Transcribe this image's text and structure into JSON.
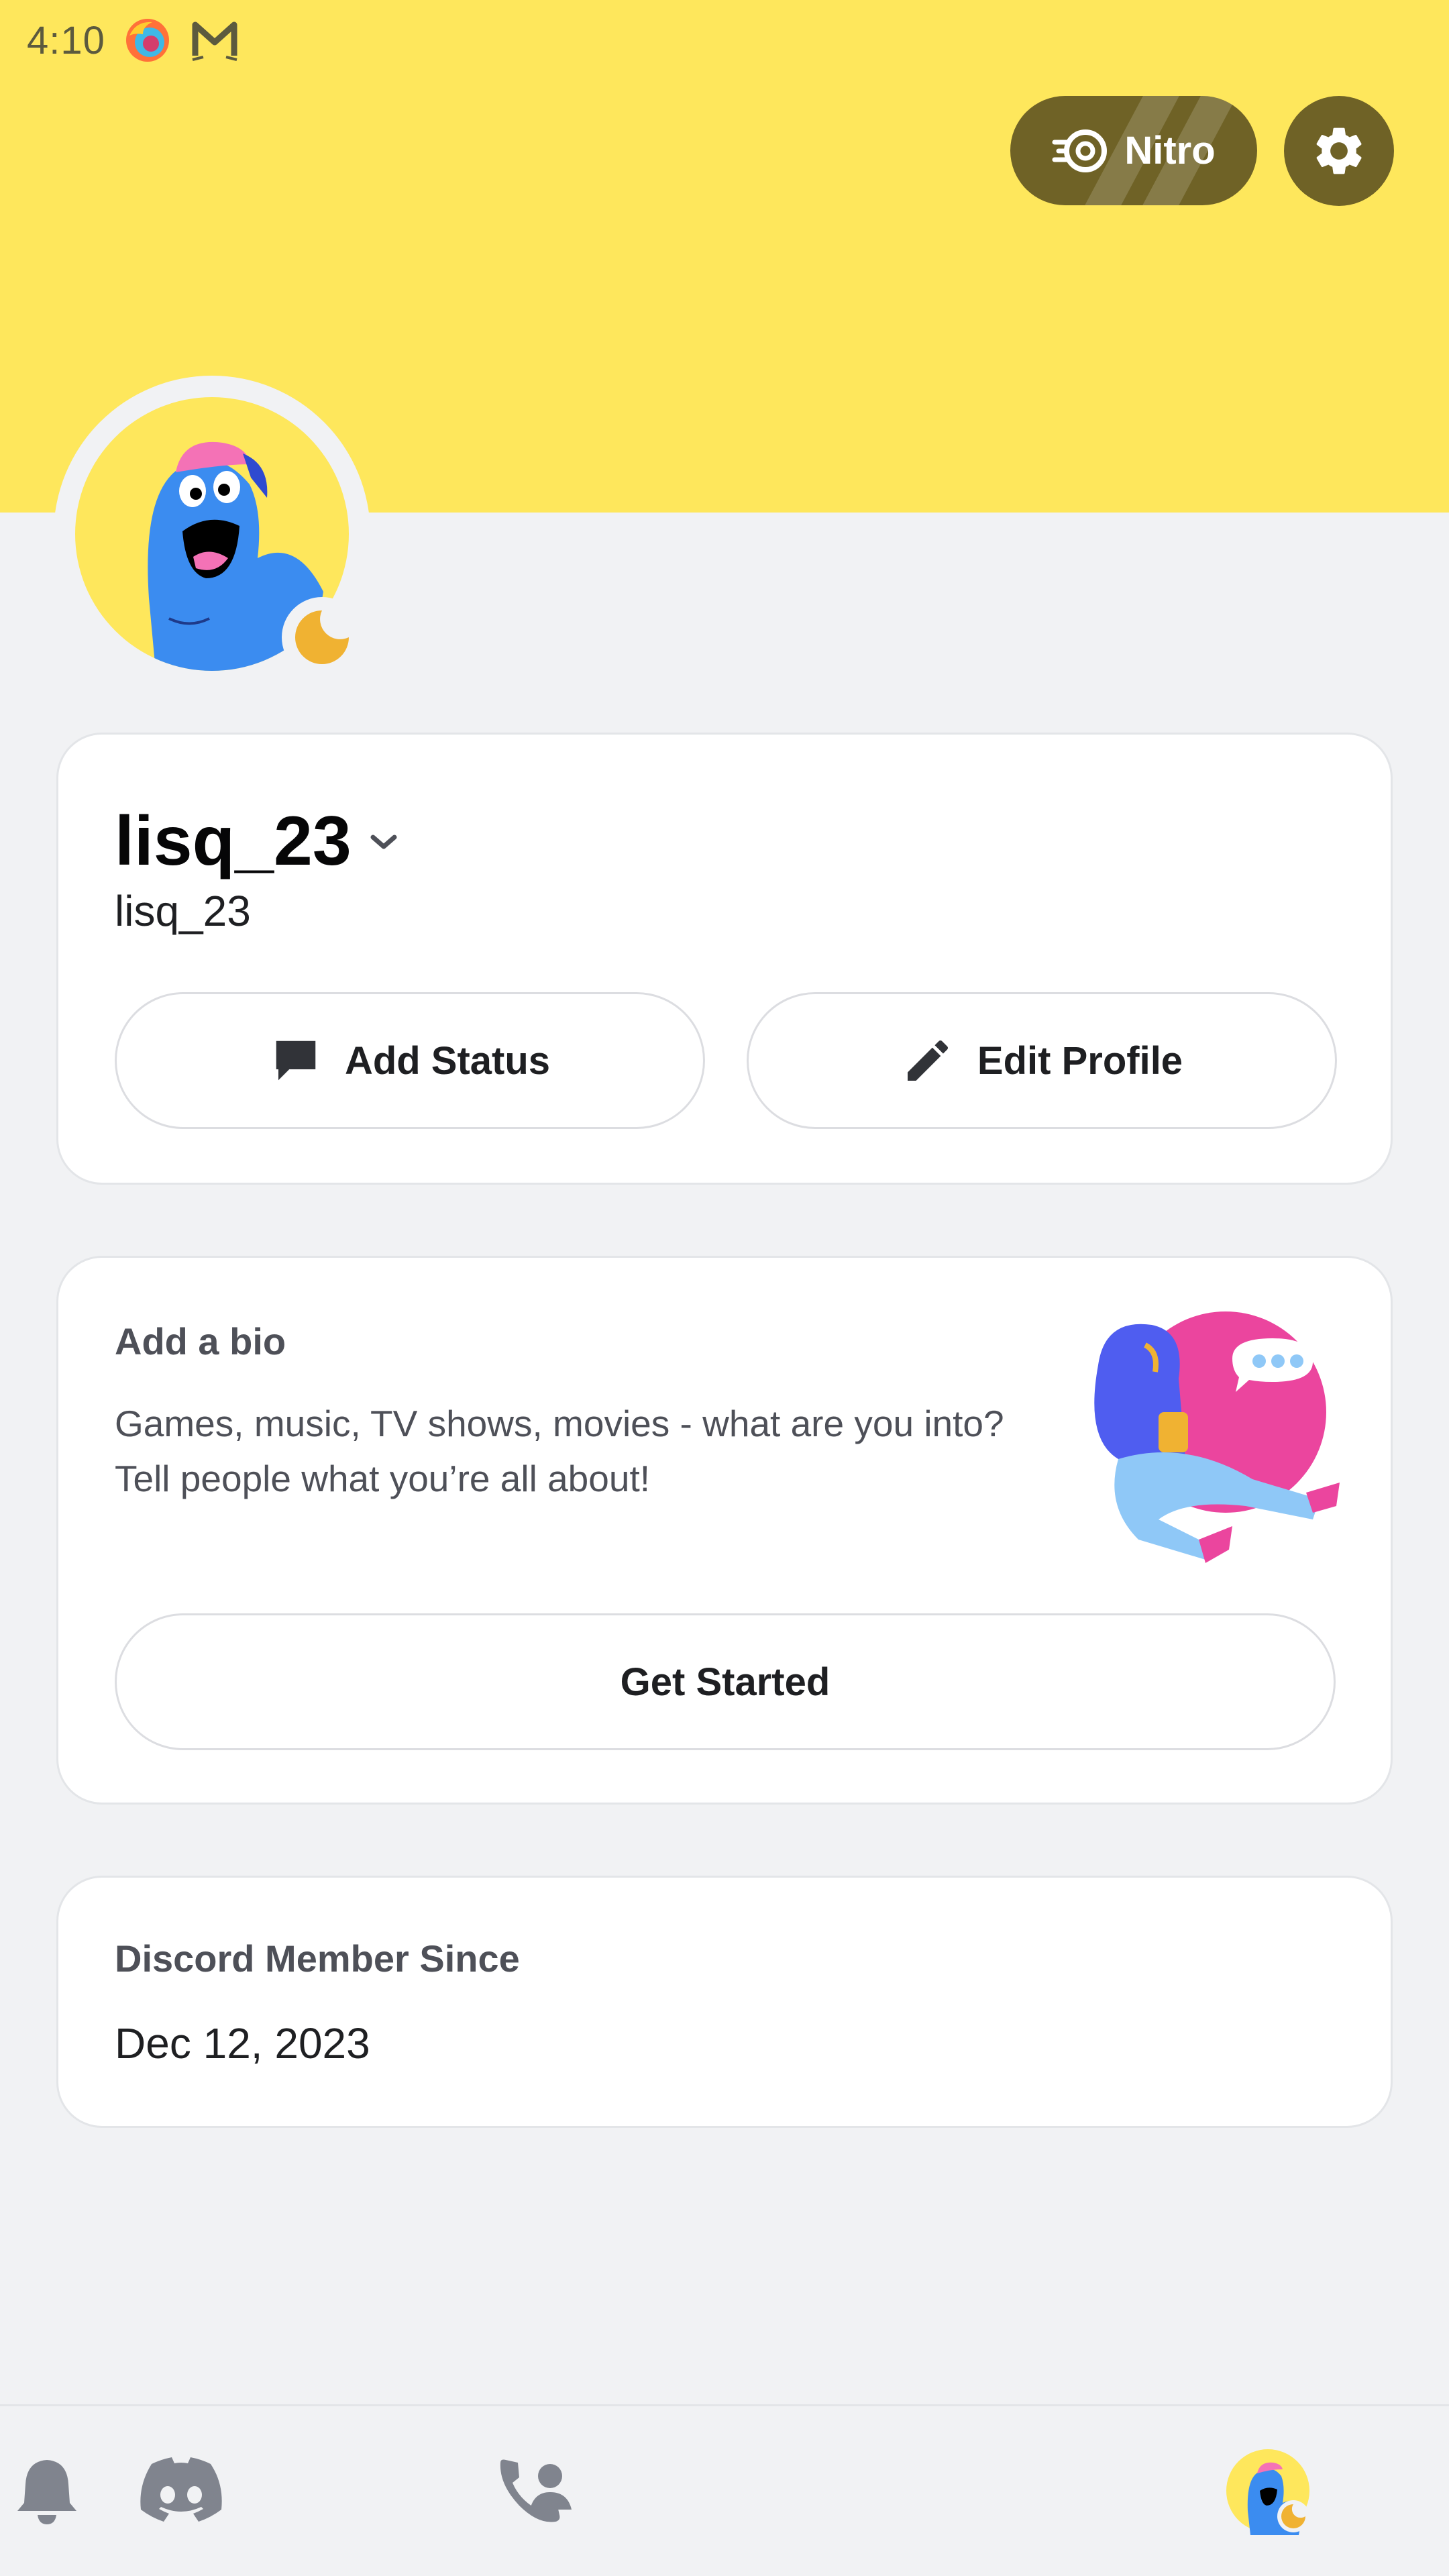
{
  "status_bar": {
    "time": "4:10",
    "icons": [
      "firefox-icon",
      "gmail-cat-icon"
    ]
  },
  "header": {
    "nitro_label": "Nitro",
    "settings_icon": "gear-icon"
  },
  "profile": {
    "display_name": "lisq_23",
    "username": "lisq_23",
    "status_indicator": "idle",
    "add_status_label": "Add Status",
    "edit_profile_label": "Edit Profile"
  },
  "bio": {
    "title": "Add a bio",
    "text": "Games, music, TV shows, movies - what are you into? Tell people what you’re all about!",
    "button_label": "Get Started"
  },
  "member_since": {
    "label": "Discord Member Since",
    "date": "Dec 12, 2023"
  },
  "bottom_nav": {
    "items": [
      "discord-home-icon",
      "friends-icon",
      "notifications-icon",
      "profile-avatar"
    ],
    "active": "profile-avatar"
  },
  "colors": {
    "banner": "#fee75c",
    "nitro_bg": "#6f6226",
    "background": "#f1f2f4",
    "idle": "#f0b232"
  }
}
